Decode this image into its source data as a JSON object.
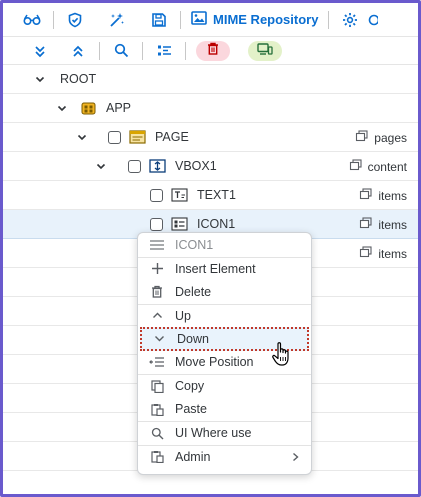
{
  "toolbar": {
    "mime_label": "MIME Repository"
  },
  "tree": {
    "rows": [
      {
        "label": "ROOT",
        "aggregation": ""
      },
      {
        "label": "APP",
        "aggregation": ""
      },
      {
        "label": "PAGE",
        "aggregation": "pages"
      },
      {
        "label": "VBOX1",
        "aggregation": "content"
      },
      {
        "label": "TEXT1",
        "aggregation": "items"
      },
      {
        "label": "ICON1",
        "aggregation": "items"
      },
      {
        "label": "",
        "aggregation": "items"
      }
    ]
  },
  "context_menu": {
    "header": "ICON1",
    "items": [
      {
        "label": "Insert Element",
        "icon": "plus-icon"
      },
      {
        "label": "Delete",
        "icon": "trash-icon"
      },
      {
        "label": "Up",
        "icon": "chevron-up-icon"
      },
      {
        "label": "Down",
        "icon": "chevron-down-icon"
      },
      {
        "label": "Move Position",
        "icon": "move-position-icon"
      },
      {
        "label": "Copy",
        "icon": "copy-icon"
      },
      {
        "label": "Paste",
        "icon": "paste-icon"
      },
      {
        "label": "UI Where use",
        "icon": "search-icon"
      },
      {
        "label": "Admin",
        "icon": "admin-icon"
      }
    ]
  },
  "colors": {
    "accent": "#0a6ed1",
    "frame": "#6a5acd",
    "delete_pill": "#fbd7dd",
    "device_pill": "#e3f1c9",
    "highlight_border": "#c0392b"
  }
}
